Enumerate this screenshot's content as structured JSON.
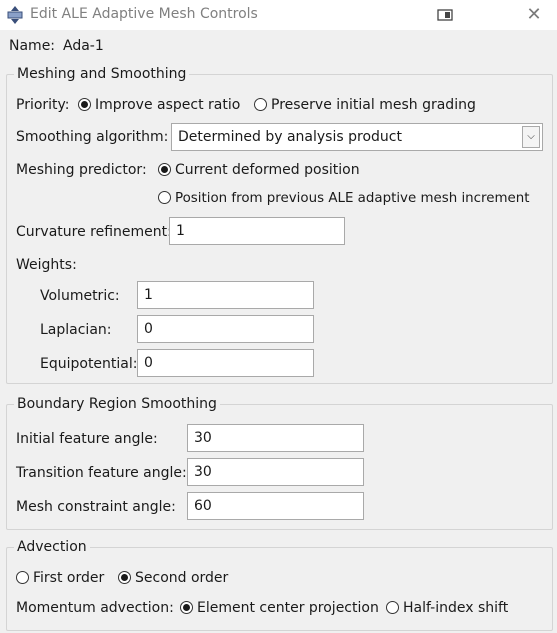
{
  "window": {
    "title": "Edit ALE Adaptive Mesh Controls"
  },
  "name_row": {
    "label": "Name:",
    "value": "Ada-1"
  },
  "meshing": {
    "legend": "Meshing and Smoothing",
    "priority_label": "Priority:",
    "priority_options": [
      "Improve aspect ratio",
      "Preserve initial mesh grading"
    ],
    "priority_selected": "Improve aspect ratio",
    "smoothing_label": "Smoothing algorithm:",
    "smoothing_value": "Determined by analysis product",
    "predictor_label": "Meshing predictor:",
    "predictor_options": [
      "Current deformed position",
      "Position from previous ALE adaptive mesh increment"
    ],
    "predictor_selected": "Current deformed position",
    "curvature_label": "Curvature refinement:",
    "curvature_value": "1",
    "weights_label": "Weights:",
    "volumetric_label": "Volumetric:",
    "volumetric_value": "1",
    "laplacian_label": "Laplacian:",
    "laplacian_value": "0",
    "equipotential_label": "Equipotential:",
    "equipotential_value": "0"
  },
  "boundary": {
    "legend": "Boundary Region Smoothing",
    "initial_label": "Initial feature angle:",
    "initial_value": "30",
    "transition_label": "Transition feature angle:",
    "transition_value": "30",
    "constraint_label": "Mesh constraint angle:",
    "constraint_value": "60"
  },
  "advection": {
    "legend": "Advection",
    "order_options": [
      "First order",
      "Second order"
    ],
    "order_selected": "Second order",
    "momentum_label": "Momentum advection:",
    "momentum_options": [
      "Element center projection",
      "Half-index shift"
    ],
    "momentum_selected": "Element center projection"
  },
  "icons": [
    "app-mesh-icon",
    "restore-icon",
    "close-icon",
    "dropdown-arrow-icon"
  ]
}
